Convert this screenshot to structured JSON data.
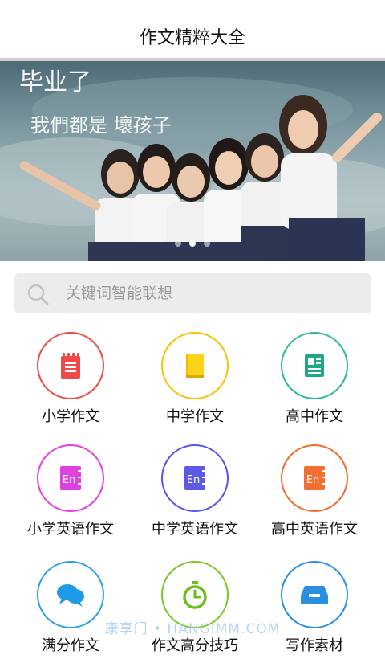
{
  "header": {
    "title": "作文精粹大全"
  },
  "banner": {
    "handwriting_line1": "毕业了",
    "handwriting_line2": "我們都是 壞孩子",
    "dots_count": 3,
    "active_dot": 1
  },
  "search": {
    "placeholder": "关键词智能联想",
    "value": ""
  },
  "categories": [
    {
      "label": "小学作文",
      "icon": "notepad-icon",
      "ring_color": "#ef4a4a",
      "icon_color": "#ef4a4a"
    },
    {
      "label": "中学作文",
      "icon": "book-icon",
      "ring_color": "#f5c300",
      "icon_color": "#f5b800"
    },
    {
      "label": "高中作文",
      "icon": "document-icon",
      "ring_color": "#2bb99a",
      "icon_color": "#1fa888"
    },
    {
      "label": "小学英语作文",
      "icon": "english-book-icon",
      "ring_color": "#e83fe0",
      "icon_color": "#e040e0",
      "icon_text": "En"
    },
    {
      "label": "中学英语作文",
      "icon": "english-book-icon",
      "ring_color": "#5a56e6",
      "icon_color": "#5d5ae8",
      "icon_text": "En"
    },
    {
      "label": "高中英语作文",
      "icon": "english-book-icon",
      "ring_color": "#f26c2c",
      "icon_color": "#f27032",
      "icon_text": "En"
    },
    {
      "label": "满分作文",
      "icon": "chat-bubbles-icon",
      "ring_color": "#2aa2e8",
      "icon_color": "#1e9be6"
    },
    {
      "label": "作文高分技巧",
      "icon": "stopwatch-icon",
      "ring_color": "#7cc829",
      "icon_color": "#6fbf1c"
    },
    {
      "label": "写作素材",
      "icon": "inbox-tray-icon",
      "ring_color": "#2a8fe0",
      "icon_color": "#2a8fe0"
    }
  ],
  "watermark": "康享门 • HANGIMM.COM"
}
